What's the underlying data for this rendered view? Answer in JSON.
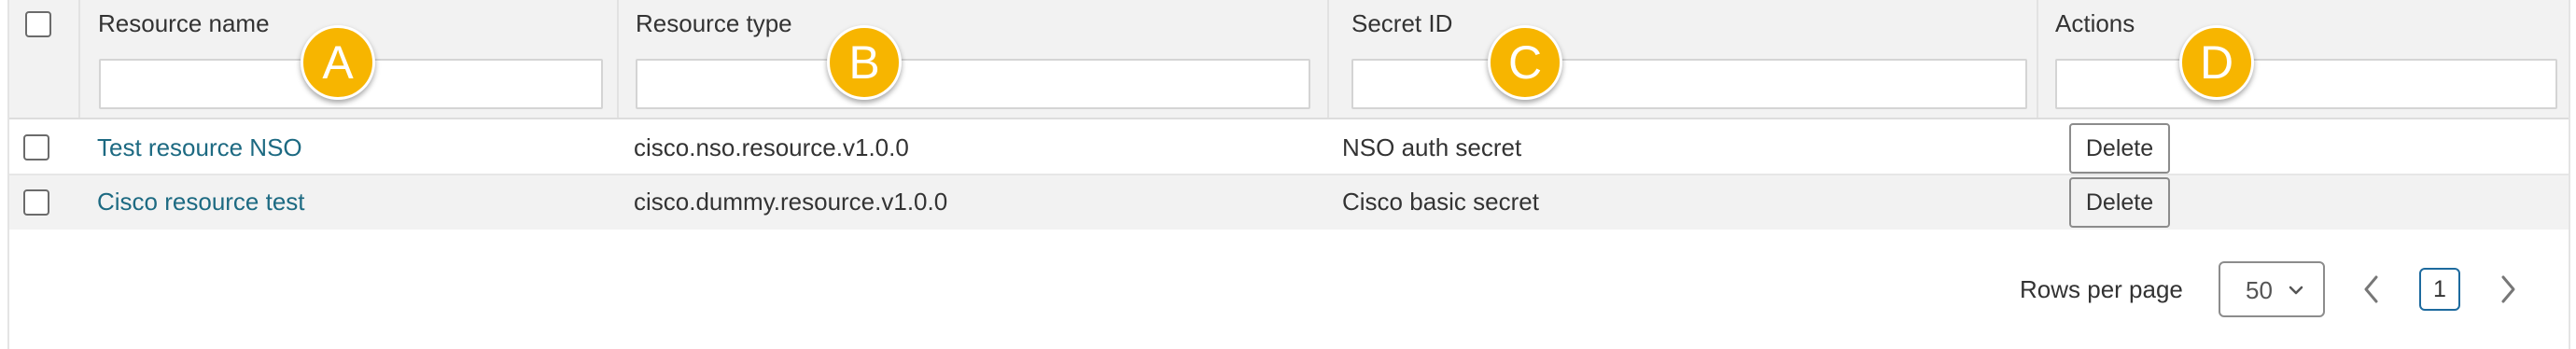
{
  "table": {
    "columns": [
      {
        "label": "Resource name",
        "filter_value": ""
      },
      {
        "label": "Resource type",
        "filter_value": ""
      },
      {
        "label": "Secret ID",
        "filter_value": ""
      },
      {
        "label": "Actions",
        "filter_value": ""
      }
    ],
    "rows": [
      {
        "name": "Test resource NSO",
        "type": "cisco.nso.resource.v1.0.0",
        "secret": "NSO auth secret",
        "action": "Delete"
      },
      {
        "name": "Cisco resource test",
        "type": "cisco.dummy.resource.v1.0.0",
        "secret": "Cisco basic secret",
        "action": "Delete"
      }
    ]
  },
  "callouts": [
    "A",
    "B",
    "C",
    "D"
  ],
  "pagination": {
    "rows_per_page_label": "Rows per page",
    "rows_per_page_value": "50",
    "current_page": "1"
  },
  "colors": {
    "link": "#1d6a82",
    "callout": "#f7b500",
    "header_bg": "#f2f2f2"
  }
}
